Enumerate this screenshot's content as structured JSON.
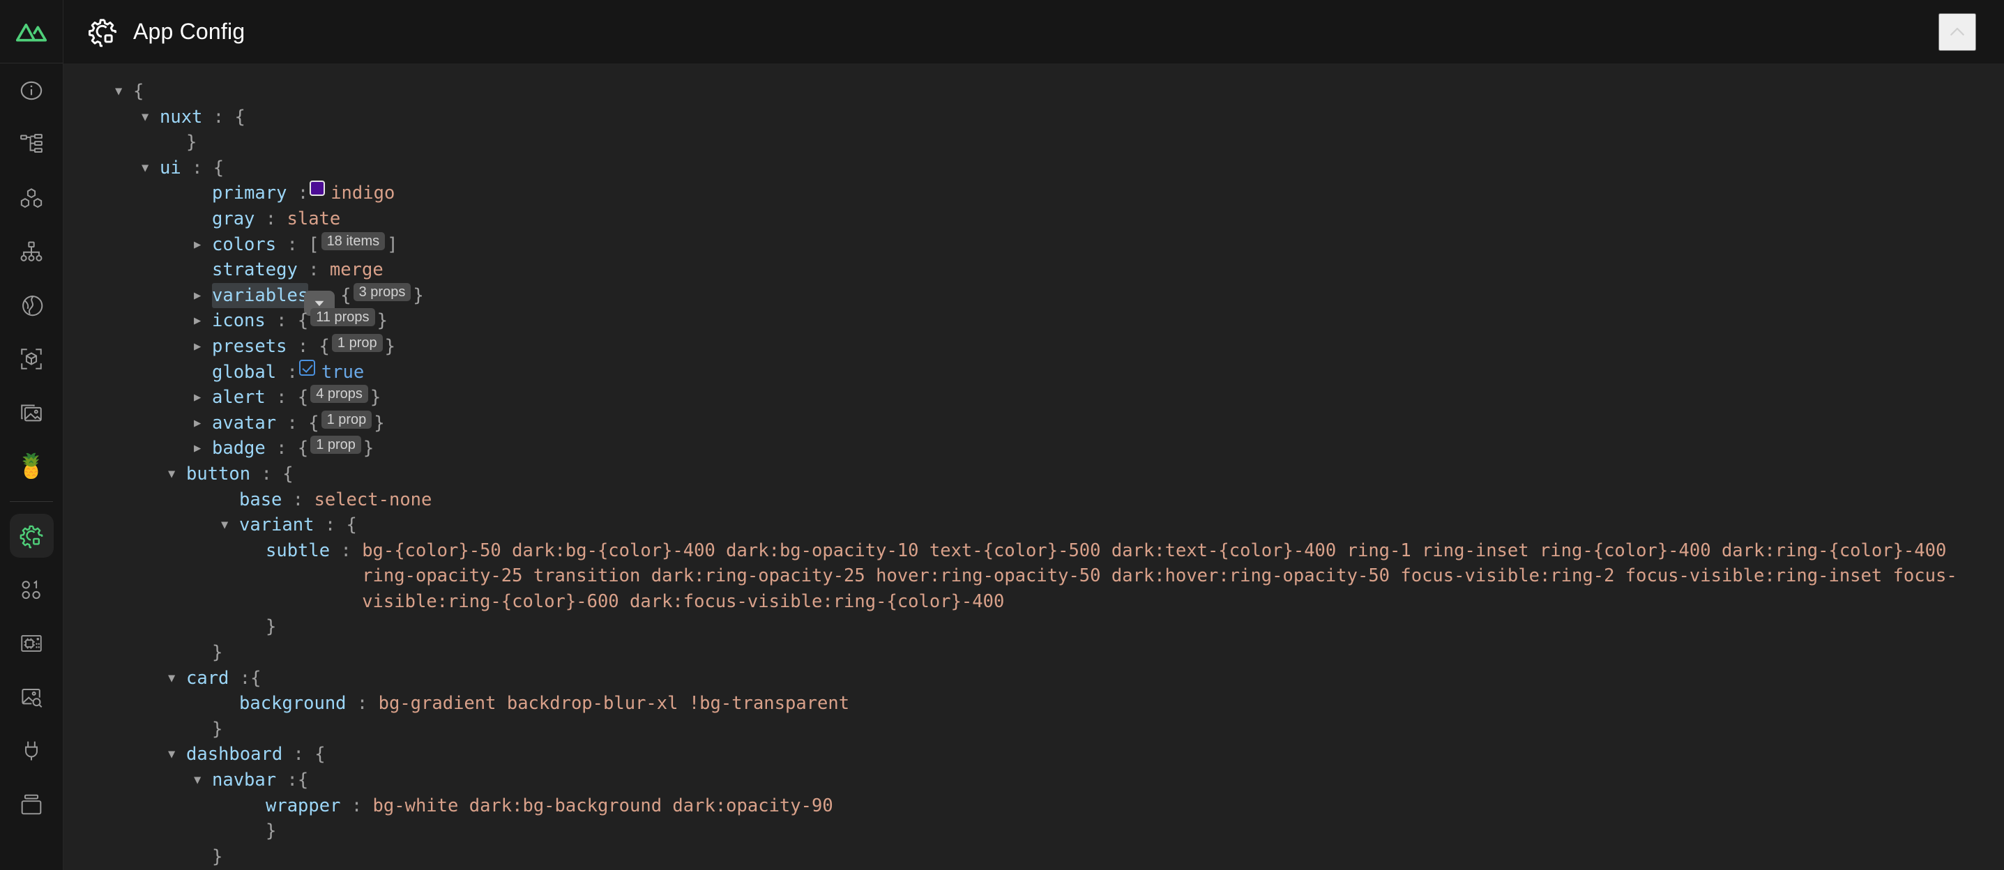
{
  "sidebar": {
    "logo": {
      "name": "nuxt-logo",
      "color": "#4fd07a"
    },
    "items": [
      {
        "icon": "info-icon",
        "label": "Overview"
      },
      {
        "icon": "sitemap-icon",
        "label": "Pages"
      },
      {
        "icon": "components-icon",
        "label": "Components"
      },
      {
        "icon": "hierarchy-icon",
        "label": "Imports"
      },
      {
        "icon": "nitro-icon",
        "label": "Server Routes"
      },
      {
        "icon": "cube-icon",
        "label": "Modules"
      },
      {
        "icon": "image-icon",
        "label": "Assets"
      },
      {
        "icon": "pinia-icon",
        "label": "Pinia",
        "emoji": "🍍"
      },
      {
        "icon": "gear-icon",
        "label": "App Config",
        "active": true
      },
      {
        "icon": "numbers-icon",
        "label": "Runtime Configs"
      },
      {
        "icon": "chip-icon",
        "label": "Payload"
      },
      {
        "icon": "image-search-icon",
        "label": "Open Graph"
      },
      {
        "icon": "plug-icon",
        "label": "Plugins"
      },
      {
        "icon": "terminal-icon",
        "label": "Terminals"
      }
    ]
  },
  "header": {
    "title": "App Config",
    "icon": "gear-icon",
    "collapse_icon": "chevron-up-icon"
  },
  "tree": {
    "root_open_brace": "{",
    "colon": ":",
    "open_brace": "{",
    "close_brace": "}",
    "open_bracket": "[",
    "close_bracket": "]",
    "rows": {
      "nuxt_key": "nuxt",
      "ui_key": "ui",
      "primary_key": "primary",
      "primary_value": "indigo",
      "primary_swatch_color": "#4c0d95",
      "gray_key": "gray",
      "gray_value": "slate",
      "colors_key": "colors",
      "colors_badge": "18 items",
      "strategy_key": "strategy",
      "strategy_value": "merge",
      "variables_key": "variables",
      "variables_badge": "3 props",
      "icons_key": "icons",
      "icons_badge": "11 props",
      "presets_key": "presets",
      "presets_badge": "1 prop",
      "global_key": "global",
      "global_value": "true",
      "alert_key": "alert",
      "alert_badge": "4 props",
      "avatar_key": "avatar",
      "avatar_badge": "1 prop",
      "badge_key": "badge",
      "badge_badge": "1 prop",
      "button_key": "button",
      "base_key": "base",
      "base_value": "select-none",
      "variant_key": "variant",
      "subtle_key": "subtle",
      "subtle_value": "bg-{color}-50 dark:bg-{color}-400 dark:bg-opacity-10 text-{color}-500 dark:text-{color}-400 ring-1 ring-inset ring-{color}-400 dark:ring-{color}-400 ring-opacity-25 transition dark:ring-opacity-25 hover:ring-opacity-50 dark:hover:ring-opacity-50 focus-visible:ring-2 focus-visible:ring-inset focus-visible:ring-{color}-600 dark:focus-visible:ring-{color}-400",
      "card_key": "card",
      "background_key": "background",
      "background_value": "bg-gradient backdrop-blur-xl !bg-transparent",
      "dashboard_key": "dashboard",
      "navbar_key": "navbar",
      "wrapper_key": "wrapper",
      "wrapper_value": "bg-white dark:bg-background dark:opacity-90"
    }
  },
  "colors": {
    "background": "#212121",
    "sidebar_background": "#161616",
    "key": "#9cd6f7",
    "string": "#d9a18a",
    "boolean": "#6aa9e8",
    "accent": "#4fd07a",
    "badge_background": "#4b4b4b"
  }
}
